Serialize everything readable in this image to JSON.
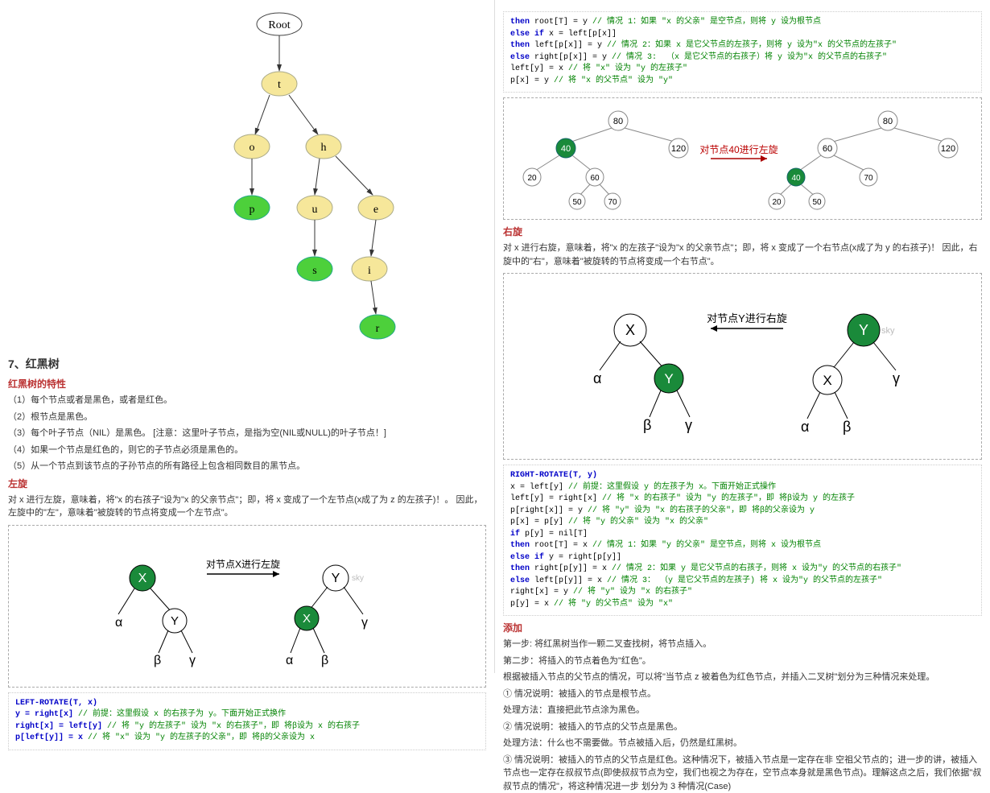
{
  "left": {
    "tree_diagram": {
      "root": "Root",
      "nodes": [
        "t",
        "o",
        "h",
        "p",
        "u",
        "e",
        "s",
        "i",
        "r"
      ]
    },
    "section7_title": "7、红黑树",
    "rb_props_title": "红黑树的特性",
    "rb_props": [
      "（1）每个节点或者是黑色，或者是红色。",
      "（2）根节点是黑色。",
      "（3）每个叶子节点（NIL）是黑色。 [注意：这里叶子节点，是指为空(NIL或NULL)的叶子节点！]",
      "（4）如果一个节点是红色的，则它的子节点必须是黑色的。",
      "（5）从一个节点到该节点的子孙节点的所有路径上包含相同数目的黑节点。"
    ],
    "left_rot_title": "左旋",
    "left_rot_para": "对 x 进行左旋，意味着，将\"x 的右孩子\"设为\"x 的父亲节点\"；即，将 x 变成了一个左节点(x成了为 z 的左孩子)！。 因此，左旋中的\"左\"，意味着\"被旋转的节点将变成一个左节点\"。",
    "left_rot_diag": {
      "label": "对节点X进行左旋",
      "left_tree": {
        "root": "X",
        "children": [
          {
            "n": "α"
          },
          {
            "n": "Y",
            "children": [
              {
                "n": "β"
              },
              {
                "n": "γ"
              }
            ]
          }
        ],
        "green": "X"
      },
      "right_tree": {
        "root": "Y",
        "children": [
          {
            "n": "X",
            "children": [
              {
                "n": "α"
              },
              {
                "n": "β"
              }
            ]
          },
          {
            "n": "γ"
          }
        ],
        "green": "X"
      },
      "watermark": "sky"
    },
    "left_rotate_code": [
      {
        "k": "LEFT-ROTATE(T, x)",
        "c": ""
      },
      {
        "k": "y = right[x]",
        "c": " // 前提：这里假设 x 的右孩子为 y。下面开始正式换作"
      },
      {
        "k": "right[x] = left[y]",
        "c": " // 将 \"y 的左孩子\" 设为 \"x 的右孩子\"，即 将β设为 x 的右孩子"
      },
      {
        "k": "p[left[y]] = x",
        "c": " // 将 \"x\" 设为 \"y 的左孩子的父亲\"，即 将β的父亲设为 x"
      }
    ]
  },
  "right": {
    "top_code": [
      {
        "k1": "then",
        "k2": " root[T] = y",
        "c": " // 情况 1：如果 \"x 的父亲\" 是空节点，则将 y 设为根节点"
      },
      {
        "k1": "else if",
        "k2": " x = left[p[x]]",
        "c": ""
      },
      {
        "k1": "then",
        "k2": " left[p[x]] = y",
        "c": " // 情况 2：如果 x 是它父节点的左孩子，则将 y 设为\"x 的父节点的左孩子\""
      },
      {
        "k1": "else",
        "k2": " right[p[x]] = y",
        "c": " // 情况 3:  （x 是它父节点的右孩子）将 y 设为\"x 的父节点的右孩子\""
      },
      {
        "k1": "",
        "k2": "left[y] = x",
        "c": " // 将 \"x\" 设为 \"y 的左孩子\""
      },
      {
        "k1": "",
        "k2": "p[x] = y",
        "c": " // 将 \"x 的父节点\" 设为 \"y\""
      }
    ],
    "ex_left_rotate": {
      "label": "对节点40进行左旋",
      "before": {
        "nodes": [
          [
            "80"
          ],
          [
            "40",
            "120"
          ],
          [
            "20",
            "60"
          ],
          [
            "50",
            "70"
          ]
        ]
      },
      "after": {
        "nodes": [
          [
            "80"
          ],
          [
            "60",
            "120"
          ],
          [
            "40",
            "70"
          ],
          [
            "20",
            "50"
          ]
        ]
      }
    },
    "right_rot_title": "右旋",
    "right_rot_para": "对 x 进行右旋，意味着，将\"x 的左孩子\"设为\"x 的父亲节点\"；即，将 x 变成了一个右节点(x成了为 y 的右孩子)！ 因此，右旋中的\"右\"，意味着\"被旋转的节点将变成一个右节点\"。",
    "right_rot_diag": {
      "label": "对节点Y进行右旋",
      "left_tree": {
        "root": "X",
        "children": [
          {
            "n": "α"
          },
          {
            "n": "Y",
            "children": [
              {
                "n": "β"
              },
              {
                "n": "γ"
              }
            ]
          }
        ],
        "green": "Y"
      },
      "right_tree": {
        "root": "Y",
        "children": [
          {
            "n": "X",
            "children": [
              {
                "n": "α"
              },
              {
                "n": "β"
              }
            ]
          },
          {
            "n": "γ"
          }
        ],
        "green": "Y"
      },
      "watermark": "sky"
    },
    "right_rotate_code": [
      {
        "k1": "",
        "k2": "RIGHT-ROTATE(T, y)",
        "c": ""
      },
      {
        "k1": "",
        "k2": "x = left[y]",
        "c": " // 前提：这里假设 y 的左孩子为 x。下面开始正式操作"
      },
      {
        "k1": "",
        "k2": "left[y] = right[x]",
        "c": " // 将 \"x 的右孩子\" 设为 \"y 的左孩子\"，即 将β设为 y 的左孩子"
      },
      {
        "k1": "",
        "k2": "p[right[x]] = y",
        "c": " // 将 \"y\" 设为 \"x 的右孩子的父亲\"，即 将β的父亲设为 y"
      },
      {
        "k1": "",
        "k2": "p[x] = p[y]",
        "c": " // 将 \"y 的父亲\" 设为 \"x 的父亲\""
      },
      {
        "k1": "if",
        "k2": " p[y] = nil[T]",
        "c": ""
      },
      {
        "k1": "then",
        "k2": " root[T] = x",
        "c": " // 情况 1：如果 \"y 的父亲\" 是空节点，则将 x 设为根节点"
      },
      {
        "k1": "else if",
        "k2": " y = right[p[y]]",
        "c": ""
      },
      {
        "k1": "then",
        "k2": " right[p[y]] = x",
        "c": " // 情况 2：如果 y 是它父节点的右孩子，则将 x 设为\"y 的父节点的右孩子\""
      },
      {
        "k1": "else",
        "k2": " left[p[y]] = x",
        "c": " // 情况 3： （y 是它父节点的左孩子) 将 x 设为\"y 的父节点的左孩子\""
      },
      {
        "k1": "",
        "k2": "right[x] = y",
        "c": " // 将 \"y\" 设为 \"x 的右孩子\""
      },
      {
        "k1": "",
        "k2": "p[y] = x",
        "c": " // 将 \"y 的父节点\" 设为 \"x\""
      }
    ],
    "insert_title": "添加",
    "insert_paras": [
      "第一步: 将红黑树当作一颗二叉查找树，将节点插入。",
      "第二步：将插入的节点着色为\"红色\"。",
      "根据被插入节点的父节点的情况，可以将\"当节点 z 被着色为红色节点，并插入二叉树\"划分为三种情况来处理。",
      "① 情况说明：被插入的节点是根节点。",
      "处理方法：直接把此节点涂为黑色。",
      "② 情况说明：被插入的节点的父节点是黑色。",
      "处理方法：什么也不需要做。节点被插入后，仍然是红黑树。",
      "",
      "③ 情况说明：被插入的节点的父节点是红色。这种情况下，被插入节点是一定存在非 空祖父节点的；进一步的讲，被插入节点也一定存在叔叔节点(即使叔叔节点为空，我们也视之为存在，空节点本身就是黑色节点)。理解这点之后，我们依据\"叔叔节点的情况\"，将这种情况进一步 划分为 3 种情况(Case)"
    ]
  }
}
